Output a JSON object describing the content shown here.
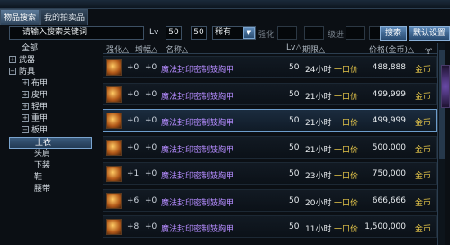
{
  "window": {
    "title": ""
  },
  "tabs": [
    {
      "label": "物品搜索",
      "active": true
    },
    {
      "label": "我的拍卖品",
      "active": false
    }
  ],
  "search": {
    "placeholder": "请输入搜索关键词",
    "value": "请输入搜索关键词",
    "lv_label": "Lv",
    "lv_min": "50",
    "lv_max": "50",
    "rarity": "稀有",
    "enhance_label": "强化",
    "grade_label": "级进",
    "search_button": "搜索",
    "default_button": "默认设置"
  },
  "sidebar": {
    "items": [
      {
        "label": "全部",
        "indent": 1,
        "toggle": "",
        "selected": false
      },
      {
        "label": "武器",
        "indent": 0,
        "toggle": "+",
        "selected": false
      },
      {
        "label": "防具",
        "indent": 0,
        "toggle": "−",
        "selected": false
      },
      {
        "label": "布甲",
        "indent": 1,
        "toggle": "+",
        "selected": false
      },
      {
        "label": "皮甲",
        "indent": 1,
        "toggle": "+",
        "selected": false
      },
      {
        "label": "轻甲",
        "indent": 1,
        "toggle": "+",
        "selected": false
      },
      {
        "label": "重甲",
        "indent": 1,
        "toggle": "+",
        "selected": false
      },
      {
        "label": "板甲",
        "indent": 1,
        "toggle": "−",
        "selected": false
      },
      {
        "label": "上衣",
        "indent": 2,
        "toggle": "",
        "selected": true
      },
      {
        "label": "头肩",
        "indent": 2,
        "toggle": "",
        "selected": false
      },
      {
        "label": "下装",
        "indent": 2,
        "toggle": "",
        "selected": false
      },
      {
        "label": "鞋",
        "indent": 2,
        "toggle": "",
        "selected": false
      },
      {
        "label": "腰带",
        "indent": 2,
        "toggle": "",
        "selected": false
      }
    ]
  },
  "table": {
    "headers": [
      "强化△",
      "增幅△",
      "名称△",
      "Lv△",
      "期限△",
      "价格(金币)△",
      "🝖"
    ],
    "rows": [
      {
        "enhance": "+0",
        "amplify": "+0",
        "name": "魔法封印密制鼓胸甲",
        "lv": "50",
        "time": "24小时",
        "mode": "一口价",
        "price": "488,888",
        "unit": "金币",
        "highlight": false
      },
      {
        "enhance": "+0",
        "amplify": "+0",
        "name": "魔法封印密制鼓胸甲",
        "lv": "50",
        "time": "21小时",
        "mode": "一口价",
        "price": "499,999",
        "unit": "金币",
        "highlight": false
      },
      {
        "enhance": "+0",
        "amplify": "+0",
        "name": "魔法封印密制鼓胸甲",
        "lv": "50",
        "time": "21小时",
        "mode": "一口价",
        "price": "499,999",
        "unit": "金币",
        "highlight": true
      },
      {
        "enhance": "+0",
        "amplify": "+0",
        "name": "魔法封印密制鼓胸甲",
        "lv": "50",
        "time": "21小时",
        "mode": "一口价",
        "price": "500,000",
        "unit": "金币",
        "highlight": false
      },
      {
        "enhance": "+1",
        "amplify": "+0",
        "name": "魔法封印密制鼓胸甲",
        "lv": "50",
        "time": "23小时",
        "mode": "一口价",
        "price": "750,000",
        "unit": "金币",
        "highlight": false
      },
      {
        "enhance": "+6",
        "amplify": "+0",
        "name": "魔法封印密制鼓胸甲",
        "lv": "50",
        "time": "20小时",
        "mode": "一口价",
        "price": "666,666",
        "unit": "金币",
        "highlight": false
      },
      {
        "enhance": "+8",
        "amplify": "+0",
        "name": "魔法封印密制鼓胸甲",
        "lv": "50",
        "time": "11小时",
        "mode": "一口价",
        "price": "1,500,000",
        "unit": "金币",
        "highlight": false
      }
    ]
  }
}
